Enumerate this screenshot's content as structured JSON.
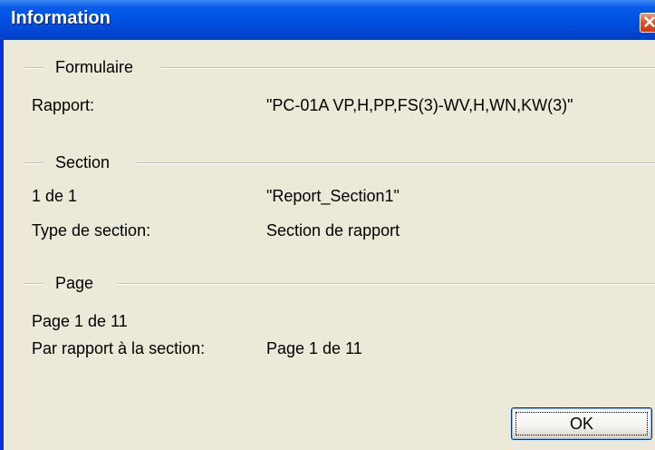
{
  "window": {
    "title": "Information",
    "close_label": "✕"
  },
  "groups": {
    "formulaire": "Formulaire",
    "section": "Section",
    "page": "Page"
  },
  "formulaire": {
    "rapport_label": "Rapport:",
    "rapport_value": "\"PC-01A VP,H,PP,FS(3)-WV,H,WN,KW(3)\""
  },
  "section": {
    "index_label": "1 de 1",
    "index_value": "\"Report_Section1\"",
    "type_label": "Type de section:",
    "type_value": "Section de rapport"
  },
  "page": {
    "page_label": "Page 1 de 11",
    "relative_label": "Par rapport à la section:",
    "relative_value": "Page 1 de 11"
  },
  "buttons": {
    "ok": "OK"
  },
  "colors": {
    "title_bar": "#0055e5",
    "client": "#ece9d8",
    "close": "#e1522d"
  }
}
